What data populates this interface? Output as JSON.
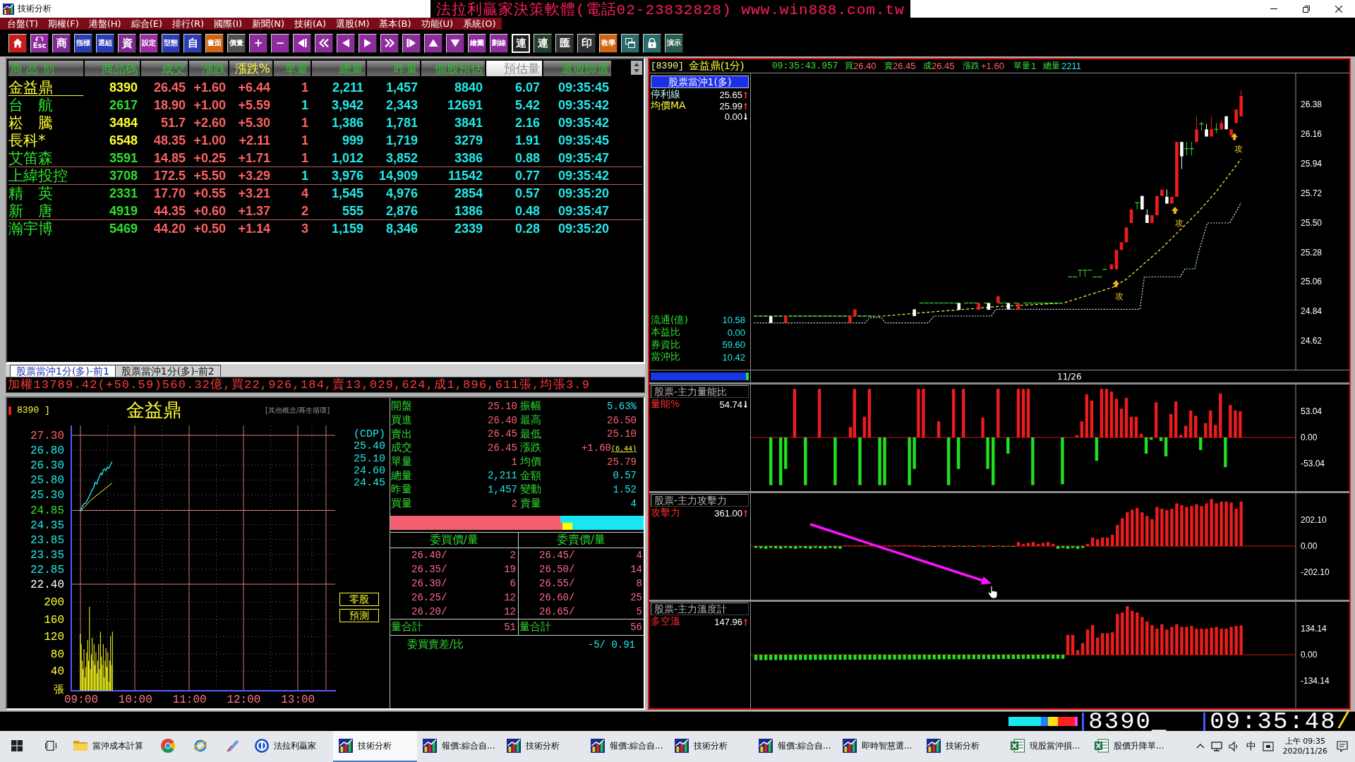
{
  "window": {
    "title": "技術分析",
    "banner": "法拉利贏家決策軟體(電話02-23832828) www.win888.com.tw"
  },
  "menu": [
    "台盤(T)",
    "期權(F)",
    "港盤(H)",
    "綜合(E)",
    "排行(R)",
    "國際(I)",
    "新聞(N)",
    "技術(A)",
    "選股(M)",
    "基本(B)",
    "功能(U)",
    "系統(O)"
  ],
  "toolbar": [
    {
      "kind": "home",
      "color": "#c81c1c",
      "selected": false
    },
    {
      "kind": "esc",
      "label": "Esc",
      "color": "#8e2c9e",
      "selected": false
    },
    {
      "kind": "text",
      "label": "商",
      "color": "#7e2a8e",
      "selected": false
    },
    {
      "kind": "text",
      "label": "指標",
      "color": "#2c3cb4",
      "selected": false
    },
    {
      "kind": "text",
      "label": "選組",
      "color": "#2c3cb4",
      "selected": false
    },
    {
      "kind": "text",
      "label": "資",
      "color": "#7e2a8e",
      "selected": false
    },
    {
      "kind": "text",
      "label": "設定",
      "color": "#9c2ca4",
      "selected": false
    },
    {
      "kind": "text",
      "label": "型態",
      "color": "#2c3cb4",
      "selected": false
    },
    {
      "kind": "text",
      "label": "自",
      "color": "#2c3cb4",
      "selected": false
    },
    {
      "kind": "text",
      "label": "畫面",
      "color": "#d0640f",
      "selected": false
    },
    {
      "kind": "text",
      "label": "價量",
      "color": "#505050",
      "selected": false
    },
    {
      "kind": "text",
      "label": "+",
      "color": "#8e2c9e",
      "selected": false
    },
    {
      "kind": "text",
      "label": "−",
      "color": "#8e2c9e",
      "selected": false
    },
    {
      "kind": "first",
      "color": "#8e2c9e",
      "selected": false
    },
    {
      "kind": "rewind",
      "color": "#8e2c9e",
      "selected": false
    },
    {
      "kind": "prev",
      "color": "#8e2c9e",
      "selected": false
    },
    {
      "kind": "next",
      "color": "#8e2c9e",
      "selected": false
    },
    {
      "kind": "forward",
      "color": "#8e2c9e",
      "selected": false
    },
    {
      "kind": "last",
      "color": "#8e2c9e",
      "selected": false
    },
    {
      "kind": "up",
      "color": "#8e2c9e",
      "selected": false
    },
    {
      "kind": "down",
      "color": "#8e2c9e",
      "selected": false
    },
    {
      "kind": "text",
      "label": "繪圖",
      "color": "#8e2c9e",
      "selected": false
    },
    {
      "kind": "text",
      "label": "劃線",
      "color": "#8e2c9e",
      "selected": false
    },
    {
      "kind": "text",
      "label": "連",
      "color": "#202020",
      "selected": true
    },
    {
      "kind": "text",
      "label": "連",
      "color": "#24402c",
      "selected": false
    },
    {
      "kind": "text",
      "label": "匯",
      "color": "#303030",
      "selected": false
    },
    {
      "kind": "text",
      "label": "印",
      "color": "#303030",
      "selected": false
    },
    {
      "kind": "text",
      "label": "教學",
      "color": "#d0640f",
      "selected": false
    },
    {
      "kind": "window",
      "color": "#2a6c6c",
      "selected": false
    },
    {
      "kind": "lock",
      "color": "#2a6c6c",
      "selected": false
    },
    {
      "kind": "text",
      "label": "演示",
      "color": "#2a5c4c",
      "selected": false
    }
  ],
  "quote_table": {
    "columns": [
      {
        "label": "商 品 別",
        "sorted": false,
        "selected": false
      },
      {
        "label": "商品碼",
        "sorted": false,
        "selected": false
      },
      {
        "label": "成交",
        "sorted": false,
        "selected": false
      },
      {
        "label": "漲跌",
        "sorted": false,
        "selected": false
      },
      {
        "label": "漲跌%",
        "sorted": true,
        "selected": false
      },
      {
        "label": "單量",
        "sorted": false,
        "selected": false
      },
      {
        "label": "總量",
        "sorted": false,
        "selected": false
      },
      {
        "label": "昨量",
        "sorted": false,
        "selected": false
      },
      {
        "label": "個股預估",
        "sorted": false,
        "selected": false
      },
      {
        "label": "預估量",
        "sorted": false,
        "selected": true
      },
      {
        "label": "選股師選",
        "sorted": false,
        "selected": false
      }
    ],
    "rows": [
      {
        "name": "金益鼎",
        "code": "8390",
        "price": "26.45",
        "change": "+1.60",
        "change_pct": "+6.44",
        "qty": {
          "text": "1",
          "color": "#ff6262"
        },
        "volume": "2,211",
        "prev_volume": "1,457",
        "forecast": "8840",
        "forecast_ratio": "6.07",
        "time": "09:35:45",
        "color": "#ffff33",
        "selected": true,
        "divider_below": false
      },
      {
        "name": "台　航",
        "code": "2617",
        "price": "18.90",
        "change": "+1.00",
        "change_pct": "+5.59",
        "qty": {
          "text": "1",
          "color": "#22eaea"
        },
        "volume": "3,942",
        "prev_volume": "2,343",
        "forecast": "12691",
        "forecast_ratio": "5.42",
        "time": "09:35:42",
        "color": "#2ee02e",
        "selected": false,
        "divider_below": false
      },
      {
        "name": "崧　騰",
        "code": "3484",
        "price": "51.7",
        "change": "+2.60",
        "change_pct": "+5.30",
        "qty": {
          "text": "1",
          "color": "#ff6262"
        },
        "volume": "1,386",
        "prev_volume": "1,781",
        "forecast": "3841",
        "forecast_ratio": "2.16",
        "time": "09:35:42",
        "color": "#ffff33",
        "selected": false,
        "divider_below": false
      },
      {
        "name": "長科*",
        "code": "6548",
        "price": "48.35",
        "change": "+1.00",
        "change_pct": "+2.11",
        "qty": {
          "text": "1",
          "color": "#ff6262"
        },
        "volume": "999",
        "prev_volume": "1,719",
        "forecast": "3279",
        "forecast_ratio": "1.91",
        "time": "09:35:45",
        "color": "#ffff33",
        "selected": false,
        "divider_below": false
      },
      {
        "name": "艾笛森",
        "code": "3591",
        "price": "14.85",
        "change": "+0.25",
        "change_pct": "+1.71",
        "qty": {
          "text": "1",
          "color": "#ff6262"
        },
        "volume": "1,012",
        "prev_volume": "3,852",
        "forecast": "3386",
        "forecast_ratio": "0.88",
        "time": "09:35:47",
        "color": "#2ee02e",
        "selected": false,
        "divider_below": true
      },
      {
        "name": "上緯投控",
        "code": "3708",
        "price": "172.5",
        "change": "+5.50",
        "change_pct": "+3.29",
        "qty": {
          "text": "1",
          "color": "#22eaea"
        },
        "volume": "3,976",
        "prev_volume": "14,909",
        "forecast": "11542",
        "forecast_ratio": "0.77",
        "time": "09:35:42",
        "color": "#2ee02e",
        "selected": false,
        "divider_below": true
      },
      {
        "name": "精　英",
        "code": "2331",
        "price": "17.70",
        "change": "+0.55",
        "change_pct": "+3.21",
        "qty": {
          "text": "4",
          "color": "#ff6262"
        },
        "volume": "1,545",
        "prev_volume": "4,976",
        "forecast": "2854",
        "forecast_ratio": "0.57",
        "time": "09:35:20",
        "color": "#2ee02e",
        "selected": false,
        "divider_below": false
      },
      {
        "name": "新　唐",
        "code": "4919",
        "price": "44.35",
        "change": "+0.60",
        "change_pct": "+1.37",
        "qty": {
          "text": "2",
          "color": "#ff6262"
        },
        "volume": "555",
        "prev_volume": "2,876",
        "forecast": "1386",
        "forecast_ratio": "0.48",
        "time": "09:35:47",
        "color": "#2ee02e",
        "selected": false,
        "divider_below": true
      },
      {
        "name": "瀚宇博",
        "code": "5469",
        "price": "44.20",
        "change": "+0.50",
        "change_pct": "+1.14",
        "qty": {
          "text": "3",
          "color": "#ff6262"
        },
        "volume": "1,159",
        "prev_volume": "8,346",
        "forecast": "2339",
        "forecast_ratio": "0.28",
        "time": "09:35:20",
        "color": "#2ee02e",
        "selected": false,
        "divider_below": false
      }
    ]
  },
  "tabs": [
    {
      "label": "股票當沖1分(多)-前1",
      "selected": true
    },
    {
      "label": "股票當沖1分(多)-前2",
      "selected": false
    }
  ],
  "ticker": "加權13789.42(+50.59)560.32億,買22,926,184,賣13,029,624,成1,896,611張,均張3.9",
  "intraday": {
    "code": "8390 ]",
    "name": "金益鼎",
    "sector": "[其他概念/再生循環]",
    "price_ticks": [
      {
        "label": "27.30",
        "color": "#ff6262"
      },
      {
        "label": "26.80",
        "color": "#22eaea"
      },
      {
        "label": "26.30",
        "color": "#22eaea"
      },
      {
        "label": "25.80",
        "color": "#22eaea"
      },
      {
        "label": "25.30",
        "color": "#22eaea"
      },
      {
        "label": "24.85",
        "color": "#2ee02e"
      },
      {
        "label": "24.35",
        "color": "#22eaea"
      },
      {
        "label": "23.85",
        "color": "#22eaea"
      },
      {
        "label": "23.35",
        "color": "#22eaea"
      },
      {
        "label": "22.85",
        "color": "#22eaea"
      },
      {
        "label": "22.40",
        "color": "#ffffff"
      }
    ],
    "volume_ticks": [
      "200",
      "160",
      "120",
      "80",
      "40"
    ],
    "volume_unit": "張",
    "time_ticks": [
      "09:00",
      "10:00",
      "11:00",
      "12:00",
      "13:00"
    ],
    "cdp": {
      "title": "(CDP)",
      "values": [
        "25.40",
        "25.10",
        "24.60",
        "24.45"
      ]
    },
    "buttons": [
      "零股",
      "預測"
    ]
  },
  "quote": {
    "fields": [
      {
        "label": "開盤",
        "value": "25.10",
        "color": "#ff6272"
      },
      {
        "label": "振幅",
        "value": "5.63%",
        "color": "#22eaea"
      },
      {
        "label": "買進",
        "value": "26.40",
        "color": "#ff6272"
      },
      {
        "label": "最高",
        "value": "26.50",
        "color": "#ff6272"
      },
      {
        "label": "賣出",
        "value": "26.45",
        "color": "#ff6272"
      },
      {
        "label": "最低",
        "value": "25.10",
        "color": "#ff6272"
      },
      {
        "label": "成交",
        "value": "26.45",
        "color": "#ff6272"
      },
      {
        "label": "漲跌",
        "value": "+1.60",
        "note": "(6.44)",
        "color": "#ff6272"
      },
      {
        "label": "單量",
        "value": "1",
        "color": "#ff6272"
      },
      {
        "label": "均價",
        "value": "25.79",
        "color": "#ff6272"
      },
      {
        "label": "總量",
        "value": "2,211",
        "color": "#22eaea"
      },
      {
        "label": "金額",
        "value": "0.57",
        "color": "#22eaea"
      },
      {
        "label": "昨量",
        "value": "1,457",
        "color": "#22eaea"
      },
      {
        "label": "變動",
        "value": "1.52",
        "color": "#22eaea"
      },
      {
        "label": "買量",
        "value": "2",
        "color": "#ff6272"
      },
      {
        "label": "賣量",
        "value": "4",
        "color": "#22eaea"
      }
    ],
    "ratio_bars": [
      {
        "level": 0.67,
        "marker": false
      },
      {
        "level": 0.68,
        "marker": true
      }
    ],
    "order_book": {
      "bid_title": "委買價/量",
      "ask_title": "委賣價/量",
      "bids": [
        {
          "price": "26.40/",
          "qty": "2"
        },
        {
          "price": "26.35/",
          "qty": "19"
        },
        {
          "price": "26.30/",
          "qty": "6"
        },
        {
          "price": "26.25/",
          "qty": "12"
        },
        {
          "price": "26.20/",
          "qty": "12"
        }
      ],
      "asks": [
        {
          "price": "26.45/",
          "qty": "4"
        },
        {
          "price": "26.50/",
          "qty": "14"
        },
        {
          "price": "26.55/",
          "qty": "8"
        },
        {
          "price": "26.60/",
          "qty": "25"
        },
        {
          "price": "26.65/",
          "qty": "5"
        }
      ],
      "bid_total": {
        "label": "量合計",
        "value": "51"
      },
      "ask_total": {
        "label": "量合計",
        "value": "56"
      },
      "imbalance": {
        "label": "委買賣差/比",
        "value": "-5/ 0.91"
      }
    }
  },
  "chart": {
    "code": "[8390]",
    "title": "金益鼎(1分)",
    "time": "09:35:43.957",
    "quotes": [
      {
        "label": "買",
        "value": "26.40",
        "color": "#ff6262"
      },
      {
        "label": "賣",
        "value": "26.45",
        "color": "#ff6262"
      },
      {
        "label": "成",
        "value": "26.45",
        "color": "#ff6262"
      },
      {
        "label": "漲跌",
        "value": "+1.60",
        "color": "#ff6262"
      },
      {
        "label": "單量",
        "value": "1",
        "color": "#3ee03e"
      },
      {
        "label": "總量",
        "value": "2211",
        "color": "#22eaea"
      }
    ],
    "study": "股票當沖1(多)",
    "lines": [
      {
        "label": "停利線",
        "value": "25.65",
        "rising": true,
        "color": "#bff4f4"
      },
      {
        "label": "均價MA",
        "value": "25.99",
        "rising": true,
        "color": "#ffff40"
      },
      {
        "value": "0.00",
        "rising": false
      }
    ],
    "stats": [
      {
        "label": "流通(億)",
        "value": "10.58"
      },
      {
        "label": "本益比",
        "value": "0.00"
      },
      {
        "label": "券資比",
        "value": "59.60"
      },
      {
        "label": "當沖比",
        "value": "10.42"
      }
    ],
    "yticks": [
      "26.38",
      "26.16",
      "25.94",
      "25.72",
      "25.50",
      "25.28",
      "25.06",
      "24.84",
      "24.62"
    ],
    "date": "11/26",
    "signals": [
      "攻",
      "攻",
      "攻"
    ]
  },
  "panels": [
    {
      "title": "股票-主力量能比",
      "label": "量能%",
      "value": "54.74",
      "rising": false,
      "yticks": [
        "53.04",
        "0.00",
        "-53.04"
      ]
    },
    {
      "title": "股票-主力攻擊力",
      "label": "攻擊力",
      "value": "361.00",
      "rising": true,
      "yticks": [
        "202.10",
        "0.00",
        "-202.10"
      ]
    },
    {
      "title": "股票-主力溫度計",
      "label": "多空溫",
      "value": "147.96",
      "rising": true,
      "yticks": [
        "134.14",
        "0.00",
        "-134.14"
      ]
    }
  ],
  "status_bar": {
    "code": "8390_",
    "time": "09:35:48",
    "separator": "/"
  },
  "taskbar": {
    "items": [
      {
        "kind": "folder",
        "label": "當沖成本計算",
        "selected": false
      },
      {
        "kind": "browser",
        "selected": false
      },
      {
        "kind": "globe",
        "selected": false
      },
      {
        "kind": "pen",
        "selected": false
      },
      {
        "kind": "app",
        "label": "法拉利贏家",
        "selected": false
      },
      {
        "kind": "chart",
        "label": "技術分析",
        "selected": true
      },
      {
        "kind": "chart",
        "label": "報價:綜合自...",
        "selected": false
      },
      {
        "kind": "chart",
        "label": "技術分析",
        "selected": false
      },
      {
        "kind": "chart",
        "label": "報價:綜合自...",
        "selected": false
      },
      {
        "kind": "chart",
        "label": "技術分析",
        "selected": false
      },
      {
        "kind": "chart",
        "label": "報價:綜合自...",
        "selected": false
      },
      {
        "kind": "chart",
        "label": "即時智慧選...",
        "selected": false
      },
      {
        "kind": "chart",
        "label": "技術分析",
        "selected": false
      },
      {
        "kind": "sheet",
        "label": "現股當沖損...",
        "selected": false
      },
      {
        "kind": "sheet",
        "label": "股價升降單...",
        "selected": false
      }
    ],
    "tray": {
      "ime": "中",
      "time": "上午 09:35",
      "date": "2020/11/26"
    }
  }
}
